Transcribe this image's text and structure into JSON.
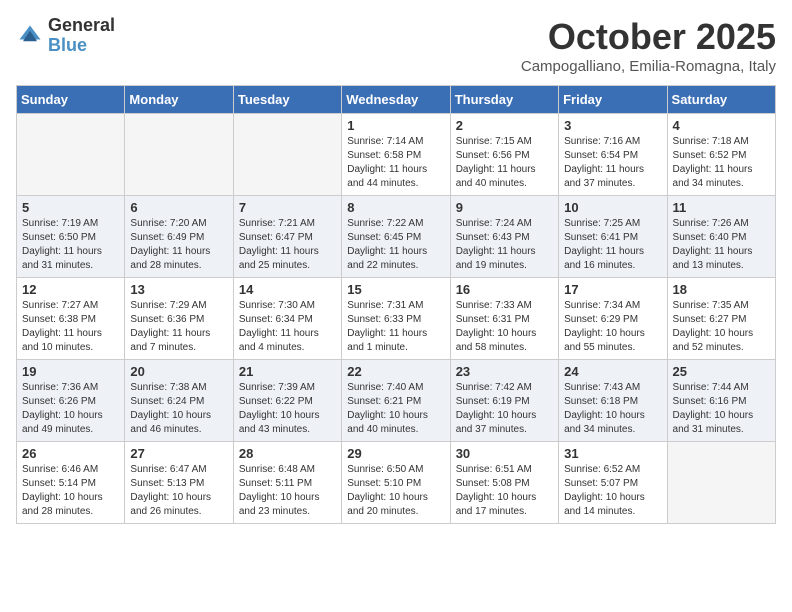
{
  "header": {
    "logo_general": "General",
    "logo_blue": "Blue",
    "month_title": "October 2025",
    "location": "Campogalliano, Emilia-Romagna, Italy"
  },
  "weekdays": [
    "Sunday",
    "Monday",
    "Tuesday",
    "Wednesday",
    "Thursday",
    "Friday",
    "Saturday"
  ],
  "weeks": [
    [
      {
        "day": "",
        "sunrise": "",
        "sunset": "",
        "daylight": ""
      },
      {
        "day": "",
        "sunrise": "",
        "sunset": "",
        "daylight": ""
      },
      {
        "day": "",
        "sunrise": "",
        "sunset": "",
        "daylight": ""
      },
      {
        "day": "1",
        "sunrise": "Sunrise: 7:14 AM",
        "sunset": "Sunset: 6:58 PM",
        "daylight": "Daylight: 11 hours and 44 minutes."
      },
      {
        "day": "2",
        "sunrise": "Sunrise: 7:15 AM",
        "sunset": "Sunset: 6:56 PM",
        "daylight": "Daylight: 11 hours and 40 minutes."
      },
      {
        "day": "3",
        "sunrise": "Sunrise: 7:16 AM",
        "sunset": "Sunset: 6:54 PM",
        "daylight": "Daylight: 11 hours and 37 minutes."
      },
      {
        "day": "4",
        "sunrise": "Sunrise: 7:18 AM",
        "sunset": "Sunset: 6:52 PM",
        "daylight": "Daylight: 11 hours and 34 minutes."
      }
    ],
    [
      {
        "day": "5",
        "sunrise": "Sunrise: 7:19 AM",
        "sunset": "Sunset: 6:50 PM",
        "daylight": "Daylight: 11 hours and 31 minutes."
      },
      {
        "day": "6",
        "sunrise": "Sunrise: 7:20 AM",
        "sunset": "Sunset: 6:49 PM",
        "daylight": "Daylight: 11 hours and 28 minutes."
      },
      {
        "day": "7",
        "sunrise": "Sunrise: 7:21 AM",
        "sunset": "Sunset: 6:47 PM",
        "daylight": "Daylight: 11 hours and 25 minutes."
      },
      {
        "day": "8",
        "sunrise": "Sunrise: 7:22 AM",
        "sunset": "Sunset: 6:45 PM",
        "daylight": "Daylight: 11 hours and 22 minutes."
      },
      {
        "day": "9",
        "sunrise": "Sunrise: 7:24 AM",
        "sunset": "Sunset: 6:43 PM",
        "daylight": "Daylight: 11 hours and 19 minutes."
      },
      {
        "day": "10",
        "sunrise": "Sunrise: 7:25 AM",
        "sunset": "Sunset: 6:41 PM",
        "daylight": "Daylight: 11 hours and 16 minutes."
      },
      {
        "day": "11",
        "sunrise": "Sunrise: 7:26 AM",
        "sunset": "Sunset: 6:40 PM",
        "daylight": "Daylight: 11 hours and 13 minutes."
      }
    ],
    [
      {
        "day": "12",
        "sunrise": "Sunrise: 7:27 AM",
        "sunset": "Sunset: 6:38 PM",
        "daylight": "Daylight: 11 hours and 10 minutes."
      },
      {
        "day": "13",
        "sunrise": "Sunrise: 7:29 AM",
        "sunset": "Sunset: 6:36 PM",
        "daylight": "Daylight: 11 hours and 7 minutes."
      },
      {
        "day": "14",
        "sunrise": "Sunrise: 7:30 AM",
        "sunset": "Sunset: 6:34 PM",
        "daylight": "Daylight: 11 hours and 4 minutes."
      },
      {
        "day": "15",
        "sunrise": "Sunrise: 7:31 AM",
        "sunset": "Sunset: 6:33 PM",
        "daylight": "Daylight: 11 hours and 1 minute."
      },
      {
        "day": "16",
        "sunrise": "Sunrise: 7:33 AM",
        "sunset": "Sunset: 6:31 PM",
        "daylight": "Daylight: 10 hours and 58 minutes."
      },
      {
        "day": "17",
        "sunrise": "Sunrise: 7:34 AM",
        "sunset": "Sunset: 6:29 PM",
        "daylight": "Daylight: 10 hours and 55 minutes."
      },
      {
        "day": "18",
        "sunrise": "Sunrise: 7:35 AM",
        "sunset": "Sunset: 6:27 PM",
        "daylight": "Daylight: 10 hours and 52 minutes."
      }
    ],
    [
      {
        "day": "19",
        "sunrise": "Sunrise: 7:36 AM",
        "sunset": "Sunset: 6:26 PM",
        "daylight": "Daylight: 10 hours and 49 minutes."
      },
      {
        "day": "20",
        "sunrise": "Sunrise: 7:38 AM",
        "sunset": "Sunset: 6:24 PM",
        "daylight": "Daylight: 10 hours and 46 minutes."
      },
      {
        "day": "21",
        "sunrise": "Sunrise: 7:39 AM",
        "sunset": "Sunset: 6:22 PM",
        "daylight": "Daylight: 10 hours and 43 minutes."
      },
      {
        "day": "22",
        "sunrise": "Sunrise: 7:40 AM",
        "sunset": "Sunset: 6:21 PM",
        "daylight": "Daylight: 10 hours and 40 minutes."
      },
      {
        "day": "23",
        "sunrise": "Sunrise: 7:42 AM",
        "sunset": "Sunset: 6:19 PM",
        "daylight": "Daylight: 10 hours and 37 minutes."
      },
      {
        "day": "24",
        "sunrise": "Sunrise: 7:43 AM",
        "sunset": "Sunset: 6:18 PM",
        "daylight": "Daylight: 10 hours and 34 minutes."
      },
      {
        "day": "25",
        "sunrise": "Sunrise: 7:44 AM",
        "sunset": "Sunset: 6:16 PM",
        "daylight": "Daylight: 10 hours and 31 minutes."
      }
    ],
    [
      {
        "day": "26",
        "sunrise": "Sunrise: 6:46 AM",
        "sunset": "Sunset: 5:14 PM",
        "daylight": "Daylight: 10 hours and 28 minutes."
      },
      {
        "day": "27",
        "sunrise": "Sunrise: 6:47 AM",
        "sunset": "Sunset: 5:13 PM",
        "daylight": "Daylight: 10 hours and 26 minutes."
      },
      {
        "day": "28",
        "sunrise": "Sunrise: 6:48 AM",
        "sunset": "Sunset: 5:11 PM",
        "daylight": "Daylight: 10 hours and 23 minutes."
      },
      {
        "day": "29",
        "sunrise": "Sunrise: 6:50 AM",
        "sunset": "Sunset: 5:10 PM",
        "daylight": "Daylight: 10 hours and 20 minutes."
      },
      {
        "day": "30",
        "sunrise": "Sunrise: 6:51 AM",
        "sunset": "Sunset: 5:08 PM",
        "daylight": "Daylight: 10 hours and 17 minutes."
      },
      {
        "day": "31",
        "sunrise": "Sunrise: 6:52 AM",
        "sunset": "Sunset: 5:07 PM",
        "daylight": "Daylight: 10 hours and 14 minutes."
      },
      {
        "day": "",
        "sunrise": "",
        "sunset": "",
        "daylight": ""
      }
    ]
  ]
}
